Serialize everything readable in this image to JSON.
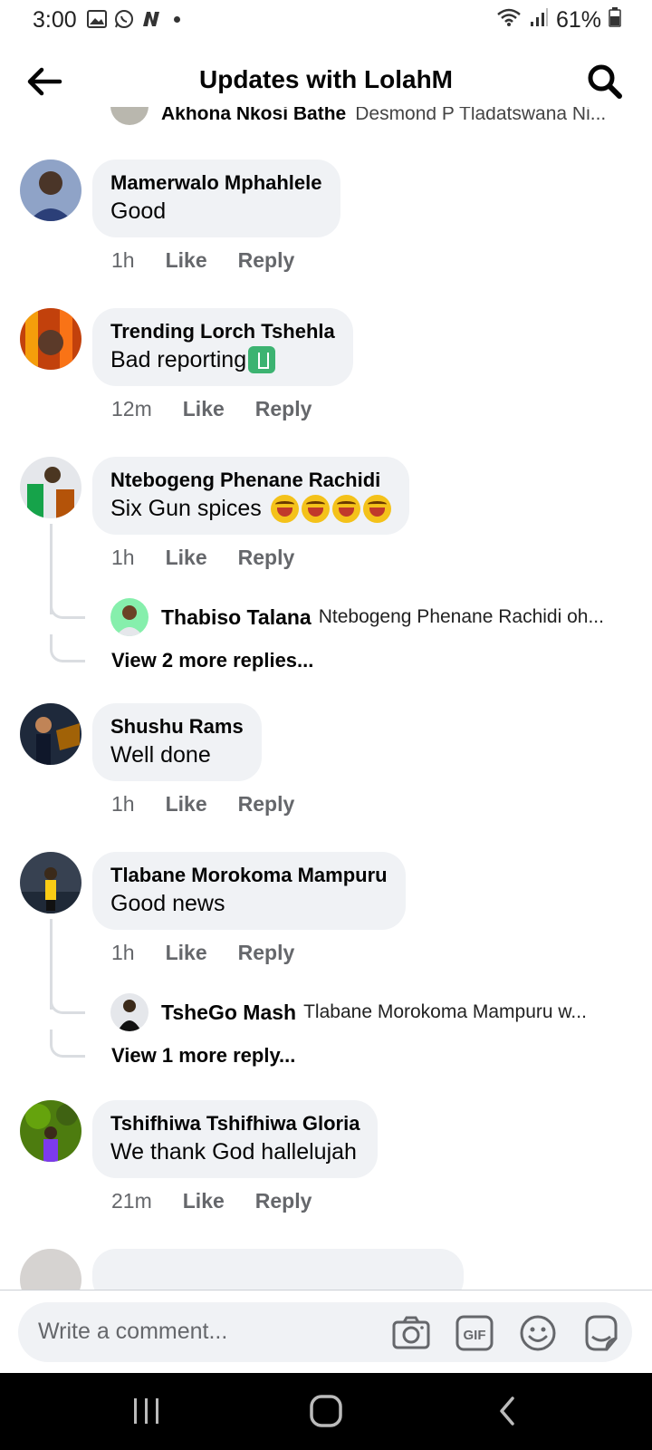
{
  "status": {
    "time": "3:00",
    "battery": "61%"
  },
  "header": {
    "title": "Updates with LolahM"
  },
  "partial_reply": {
    "name": "Akhona Nkosi Bathe",
    "text": "Desmond P Tladatswana Ni..."
  },
  "comments": [
    {
      "name": "Mamerwalo Mphahlele",
      "text": "Good",
      "time": "1h",
      "like": "Like",
      "reply": "Reply"
    },
    {
      "name": "Trending Lorch Tshehla",
      "text": "Bad reporting",
      "time": "12m",
      "like": "Like",
      "reply": "Reply"
    },
    {
      "name": "Ntebogeng Phenane Rachidi",
      "text": "Six Gun spices",
      "time": "1h",
      "like": "Like",
      "reply": "Reply",
      "reply_preview": {
        "name": "Thabiso Talana",
        "text": "Ntebogeng Phenane Rachidi oh..."
      },
      "view_more": "View 2 more replies..."
    },
    {
      "name": "Shushu Rams",
      "text": "Well done",
      "time": "1h",
      "like": "Like",
      "reply": "Reply"
    },
    {
      "name": "Tlabane Morokoma Mampuru",
      "text": "Good news",
      "time": "1h",
      "like": "Like",
      "reply": "Reply",
      "reply_preview": {
        "name": "TsheGo Mash",
        "text": "Tlabane Morokoma Mampuru w..."
      },
      "view_more": "View 1 more reply..."
    },
    {
      "name": "Tshifhiwa Tshifhiwa Gloria",
      "text": "We thank God hallelujah",
      "time": "21m",
      "like": "Like",
      "reply": "Reply"
    }
  ],
  "composer": {
    "placeholder": "Write a comment..."
  },
  "icons": {
    "status_left": [
      "gallery-icon",
      "whatsapp-icon",
      "n-app-icon"
    ],
    "status_right": [
      "wifi-icon",
      "signal-icon",
      "battery-icon"
    ],
    "composer": [
      "camera-icon",
      "gif-icon",
      "emoji-icon",
      "sticker-icon"
    ],
    "nav": [
      "recents-icon",
      "home-icon",
      "back-icon"
    ]
  },
  "colors": {
    "bubble": "#f0f2f5",
    "meta": "#65676b"
  }
}
